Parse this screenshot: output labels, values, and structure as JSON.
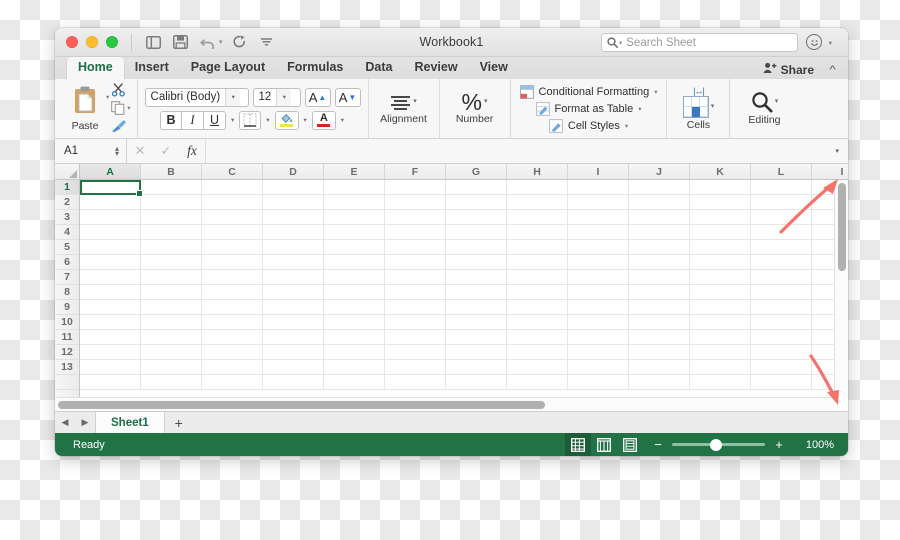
{
  "window": {
    "title": "Workbook1",
    "traffic": {
      "close": "close-window",
      "minimize": "minimize-window",
      "maximize": "maximize-window"
    },
    "quick_access": [
      "sidebar-toggle-icon",
      "save-icon",
      "undo-icon",
      "redo-icon",
      "customize-toolbar-icon"
    ]
  },
  "search": {
    "placeholder": "Search Sheet",
    "value": ""
  },
  "ribbon": {
    "tabs": [
      {
        "label": "Home",
        "active": true
      },
      {
        "label": "Insert",
        "active": false
      },
      {
        "label": "Page Layout",
        "active": false
      },
      {
        "label": "Formulas",
        "active": false
      },
      {
        "label": "Data",
        "active": false
      },
      {
        "label": "Review",
        "active": false
      },
      {
        "label": "View",
        "active": false
      }
    ],
    "share_label": "Share",
    "clipboard": {
      "paste_label": "Paste",
      "cut": "scissors-icon",
      "copy": "copy-icon",
      "format_painter": "format-painter-icon"
    },
    "font": {
      "name": "Calibri (Body)",
      "size": "12",
      "grow_label": "A",
      "shrink_label": "A",
      "bold": "B",
      "italic": "I",
      "underline": "U",
      "borders": "borders-icon",
      "fill_color": "#f2e63a",
      "font_color_letter": "A",
      "font_color": "#e02020"
    },
    "alignment": {
      "label": "Alignment"
    },
    "number": {
      "label": "Number",
      "glyph": "%"
    },
    "styles": [
      {
        "label": "Conditional Formatting",
        "icon": "conditional-formatting-icon"
      },
      {
        "label": "Format as Table",
        "icon": "format-as-table-icon"
      },
      {
        "label": "Cell Styles",
        "icon": "cell-styles-icon"
      }
    ],
    "cells": {
      "label": "Cells"
    },
    "editing": {
      "label": "Editing",
      "glyph": "search-icon"
    }
  },
  "formula_bar": {
    "name_box": "A1",
    "cancel": "cancel-icon",
    "confirm": "confirm-icon",
    "fx": "fx",
    "formula_value": "",
    "expand": "expand-formula-bar-icon"
  },
  "grid": {
    "columns": [
      "A",
      "B",
      "C",
      "D",
      "E",
      "F",
      "G",
      "H",
      "I",
      "J",
      "K",
      "L",
      "I"
    ],
    "rows": [
      "1",
      "2",
      "3",
      "4",
      "5",
      "6",
      "7",
      "8",
      "9",
      "10",
      "11",
      "12",
      "13"
    ],
    "active_cell": "A1",
    "active_column": "A",
    "active_row": "1"
  },
  "sheets": {
    "prev": "previous-sheet-icon",
    "next": "next-sheet-icon",
    "tabs": [
      {
        "label": "Sheet1",
        "active": true
      }
    ],
    "add": "+"
  },
  "status_bar": {
    "message": "Ready",
    "views": [
      "normal-view-icon",
      "page-layout-view-icon",
      "page-break-view-icon"
    ],
    "zoom_out": "−",
    "zoom_in": "+",
    "zoom_level": "100%"
  },
  "annotations": [
    {
      "name": "scrollbar-top-arrow",
      "color": "#f4736a",
      "direction": "up-right"
    },
    {
      "name": "scrollbar-bottom-arrow",
      "color": "#f4736a",
      "direction": "down-right"
    }
  ],
  "colors": {
    "excel_green": "#217346",
    "annotation_red": "#f4736a"
  }
}
